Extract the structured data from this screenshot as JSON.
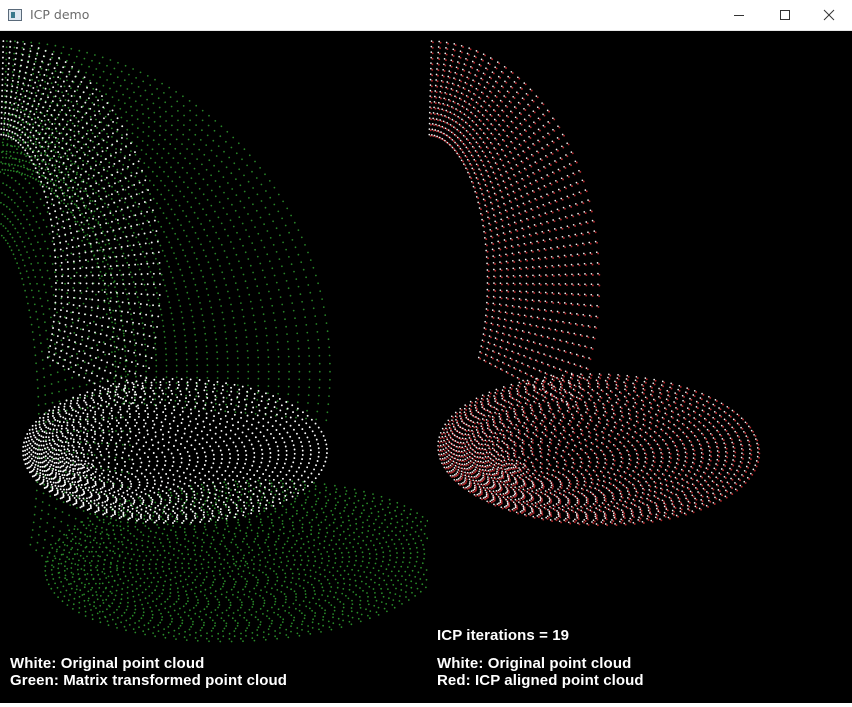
{
  "window": {
    "title": "ICP demo",
    "controls": [
      "minimize-icon",
      "maximize-icon",
      "close-icon"
    ]
  },
  "colors": {
    "background": "#000000",
    "original": "#ffffff",
    "transformed": "#2e9a2e",
    "aligned": "#c0292e"
  },
  "left_panel": {
    "legend_white": "White: Original point cloud",
    "legend_green": "Green: Matrix transformed point cloud"
  },
  "right_panel": {
    "iterations_text": "ICP iterations = 19",
    "legend_white": "White: Original point cloud",
    "legend_red": "Red: ICP aligned point cloud"
  }
}
